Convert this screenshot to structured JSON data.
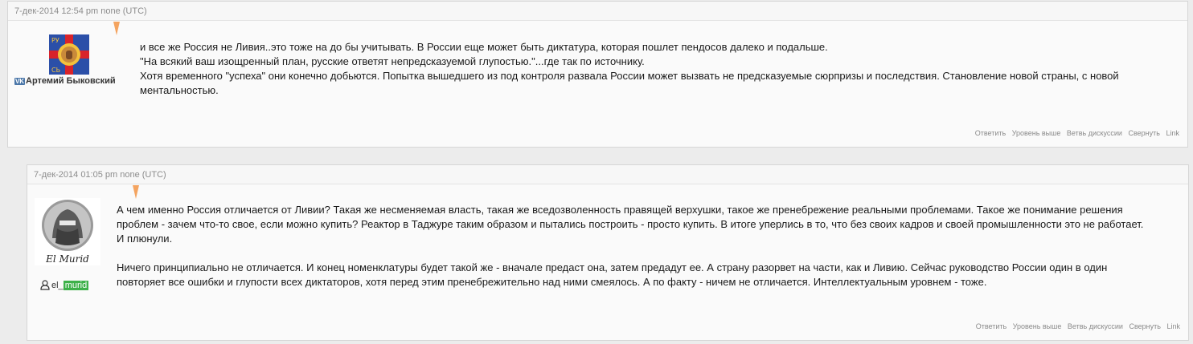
{
  "comments": [
    {
      "header": "7-дек-2014 12:54 pm none (UTC)",
      "author": "Артемий Быковский",
      "author_badge": "VK",
      "lines": [
        "и все же Россия не Ливия..это тоже на до бы учитывать. В России еще может быть диктатура, которая пошлет пендосов далеко и подальше.",
        "\"На всякий ваш изощренный план, русские ответят непредсказуемой глупостью.\"...где так по источнику.",
        "Хотя временного \"успеха\" они конечно добьются. Попытка вышедшего из под контроля развала России может вызвать не предсказуемые сюрпризы и последствия. Становление новой страны, с новой ментальностью."
      ],
      "actions": {
        "reply": "Ответить",
        "up": "Уровень выше",
        "thread": "Ветвь дискуссии",
        "collapse": "Свернуть",
        "link": "Link"
      },
      "avatar_letters": {
        "top": "РУ",
        "bottom": "СЬ"
      }
    },
    {
      "header": "7-дек-2014 01:05 pm none (UTC)",
      "author_prefix": "el_",
      "author_highlight": "murid",
      "avatar_caption": "El Murid",
      "paragraphs": [
        "А чем именно Россия отличается от Ливии? Такая же несменяемая власть, такая же вседозволенность правящей верхушки, такое же пренебрежение реальными проблемами. Такое же понимание решения проблем - зачем что-то свое, если можно купить? Реактор в Таджуре таким образом и пытались построить - просто купить. В итоге уперлись в то, что без своих кадров и своей промышленности это не работает. И плюнули.",
        "Ничего принципиально не отличается. И конец номенклатуры будет такой же - вначале предаст она, затем предадут ее. А страну разорвет на части, как и Ливию. Сейчас руководство России один в один повторяет все ошибки и глупости всех диктаторов, хотя перед этим пренебрежительно над ними смеялось. А по факту - ничем не отличается. Интеллектуальным уровнем - тоже."
      ],
      "actions": {
        "reply": "Ответить",
        "up": "Уровень выше",
        "thread": "Ветвь дискуссии",
        "collapse": "Свернуть",
        "link": "Link"
      }
    }
  ]
}
